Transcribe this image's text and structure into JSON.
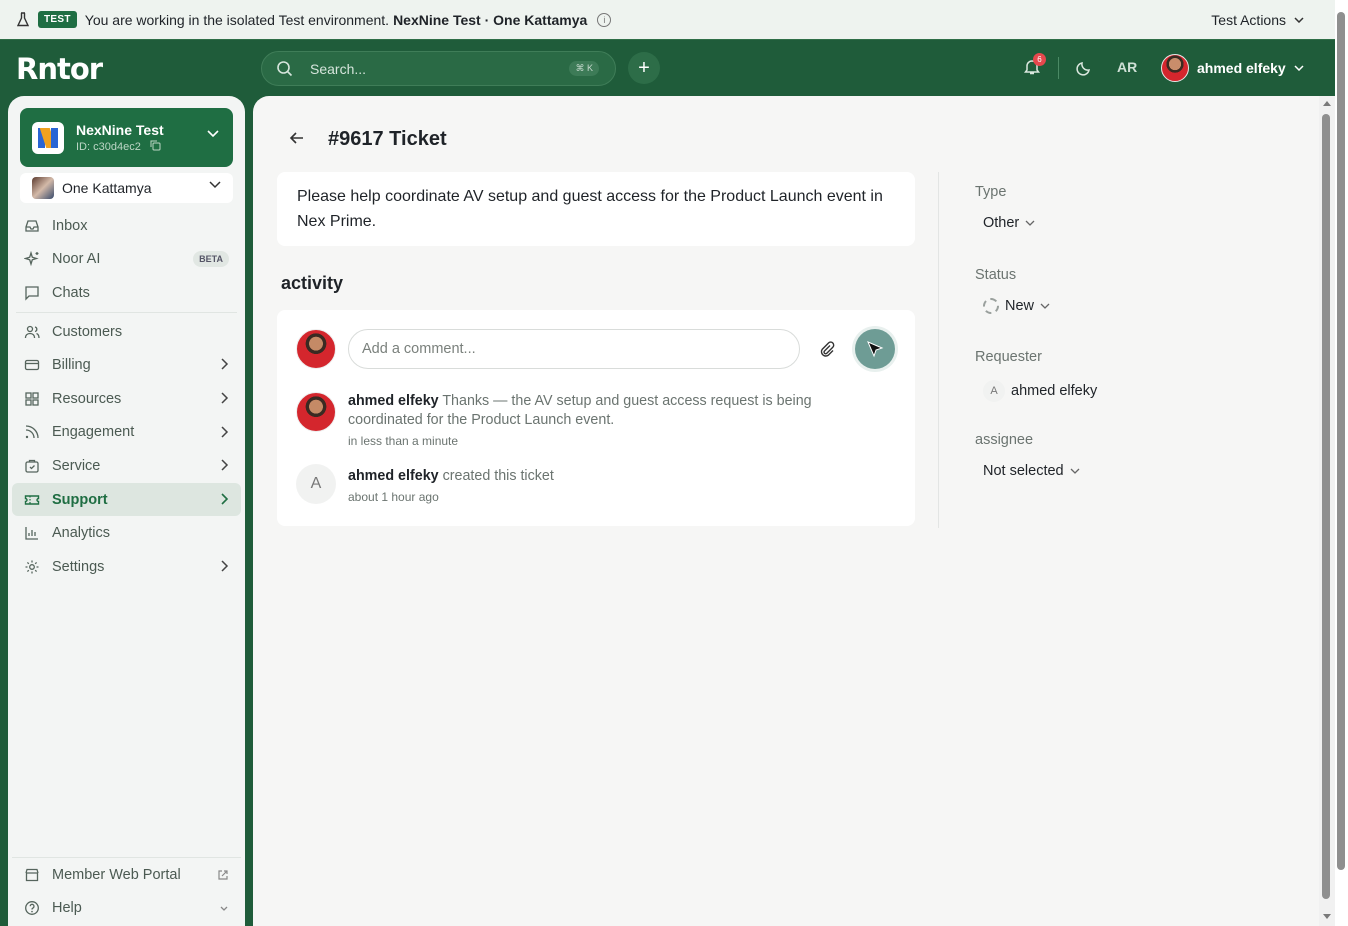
{
  "banner": {
    "tag": "TEST",
    "message": "You are working in the isolated Test environment.",
    "context": "NexNine Test · One Kattamya",
    "actions_label": "Test Actions"
  },
  "header": {
    "logo": "Rntor",
    "search_placeholder": "Search...",
    "search_shortcut": "⌘ K",
    "notification_count": "6",
    "language": "AR",
    "user_name": "ahmed elfeky"
  },
  "sidebar": {
    "org_name": "NexNine Test",
    "org_id": "ID: c30d4ec2",
    "building": "One Kattamya",
    "items": [
      {
        "label": "Inbox"
      },
      {
        "label": "Noor AI",
        "badge": "BETA"
      },
      {
        "label": "Chats"
      },
      {
        "label": "Customers"
      },
      {
        "label": "Billing"
      },
      {
        "label": "Resources"
      },
      {
        "label": "Engagement"
      },
      {
        "label": "Service"
      },
      {
        "label": "Support"
      },
      {
        "label": "Analytics"
      },
      {
        "label": "Settings"
      }
    ],
    "bottom": [
      {
        "label": "Member Web Portal"
      },
      {
        "label": "Help"
      }
    ]
  },
  "ticket": {
    "title": "#9617 Ticket",
    "description": "Please help coordinate AV setup and guest access for the Product Launch event in Nex Prime.",
    "activity_heading": "activity",
    "comment_placeholder": "Add a comment...",
    "entries": [
      {
        "author": "ahmed elfeky",
        "text": "Thanks — the AV setup and guest access request is being coordinated for the Product Launch event.",
        "time": "in less than a minute"
      },
      {
        "author": "ahmed elfeky",
        "avatar_letter": "A",
        "text": "created this ticket",
        "time": "about 1 hour ago"
      }
    ]
  },
  "properties": {
    "type_label": "Type",
    "type_value": "Other",
    "status_label": "Status",
    "status_value": "New",
    "requester_label": "Requester",
    "requester_letter": "A",
    "requester_value": "ahmed elfeky",
    "assignee_label": "assignee",
    "assignee_value": "Not selected"
  },
  "colors": {
    "brand": "#1f5c3a",
    "accent": "#1f6e43",
    "send_button": "#6e9c95",
    "badge_red": "#e5484d"
  }
}
